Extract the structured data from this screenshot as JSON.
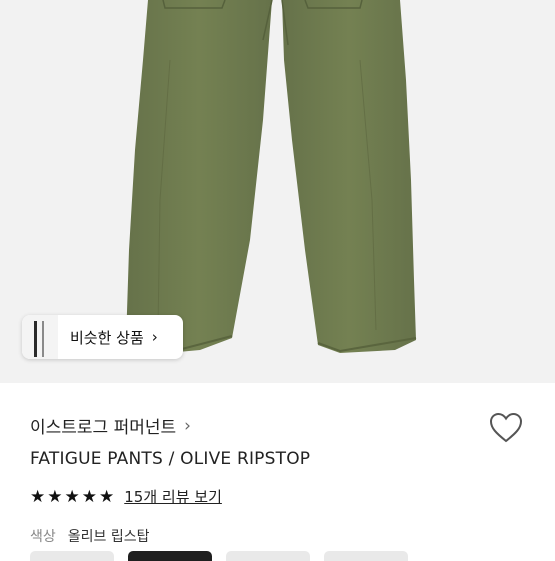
{
  "hero": {
    "similar_label": "비슷한 상품",
    "similar_chevron": "›",
    "pant_color": "#6d7a4e"
  },
  "product": {
    "brand": "이스트로그 퍼머넌트",
    "brand_chevron": "›",
    "name": "FATIGUE PANTS / OLIVE RIPSTOP",
    "rating_stars": 5,
    "review_text": "15개 리뷰 보기",
    "color_label": "색상",
    "color_value": "올리브 립스탑"
  },
  "icons": [
    "heart-icon",
    "star-icon",
    "chevron-right-icon"
  ]
}
